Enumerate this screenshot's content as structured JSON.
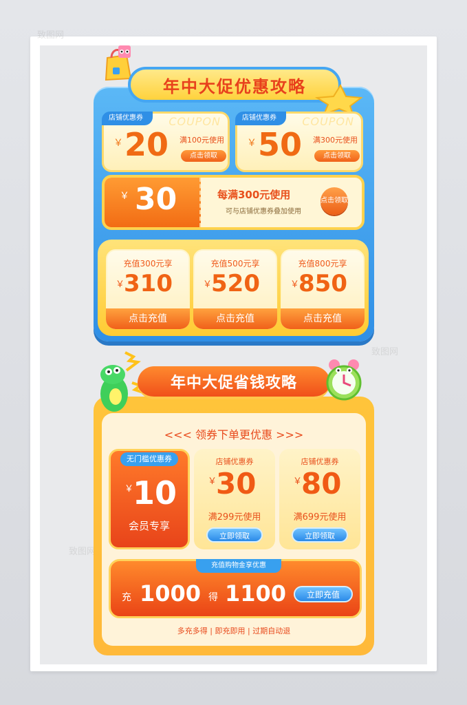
{
  "section1": {
    "title": "年中大促优惠攻略",
    "coupons": [
      {
        "tag": "店铺优惠券",
        "watermark": "COUPON",
        "yen": "￥",
        "amount": "20",
        "condition": "满100元使用",
        "button": "点击领取"
      },
      {
        "tag": "店铺优惠券",
        "watermark": "COUPON",
        "yen": "￥",
        "amount": "50",
        "condition": "满300元使用",
        "button": "点击领取"
      }
    ],
    "big_coupon": {
      "yen": "￥",
      "amount": "30",
      "main": "每满300元使用",
      "sub": "可与店铺优惠券叠加使用",
      "button": "点击领取"
    },
    "recharge": [
      {
        "label": "充值300元享",
        "yen": "￥",
        "amount": "310",
        "button": "点击充值"
      },
      {
        "label": "充值500元享",
        "yen": "￥",
        "amount": "520",
        "button": "点击充值"
      },
      {
        "label": "充值800元享",
        "yen": "￥",
        "amount": "850",
        "button": "点击充值"
      }
    ]
  },
  "section2": {
    "title": "年中大促省钱攻略",
    "lead": "<<< 领券下单更优惠 >>>",
    "vip": {
      "tag": "无门槛优惠券",
      "yen": "￥",
      "amount": "10",
      "caption": "会员专享"
    },
    "coupons": [
      {
        "tag": "店铺优惠券",
        "yen": "￥",
        "amount": "30",
        "condition": "满299元使用",
        "button": "立即领取"
      },
      {
        "tag": "店铺优惠券",
        "yen": "￥",
        "amount": "80",
        "condition": "满699元使用",
        "button": "立即领取"
      }
    ],
    "topup": {
      "tag": "充值购物金享优惠",
      "charge_label": "充",
      "charge_value": "1000",
      "get_label": "得",
      "get_value": "1100",
      "button": "立即充值"
    },
    "footer": "多充多得 | 即充即用 | 过期自动退"
  },
  "watermark_text": "致图网",
  "colors": {
    "accent_orange": "#f06314",
    "accent_blue": "#2f8fe6",
    "accent_yellow": "#ffd23c"
  }
}
